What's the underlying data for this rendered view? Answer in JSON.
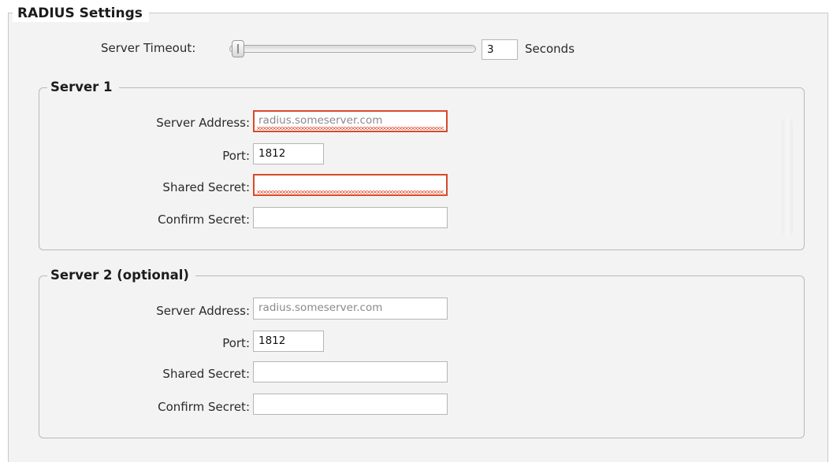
{
  "radius": {
    "title": "RADIUS Settings",
    "timeout": {
      "label": "Server Timeout:",
      "value": "3",
      "unit": "Seconds",
      "slider_level": 0.0
    }
  },
  "server1": {
    "title": "Server 1",
    "address_label": "Server Address:",
    "address_placeholder": "radius.someserver.com",
    "port_label": "Port:",
    "port_value": "1812",
    "secret_label": "Shared Secret:",
    "confirm_label": "Confirm Secret:"
  },
  "server2": {
    "title": "Server 2 (optional)",
    "address_label": "Server Address:",
    "address_placeholder": "radius.someserver.com",
    "port_label": "Port:",
    "port_value": "1812",
    "secret_label": "Shared Secret:",
    "confirm_label": "Confirm Secret:"
  },
  "colors": {
    "error_border": "#d64a2a",
    "panel_background": "#f3f3f3"
  }
}
